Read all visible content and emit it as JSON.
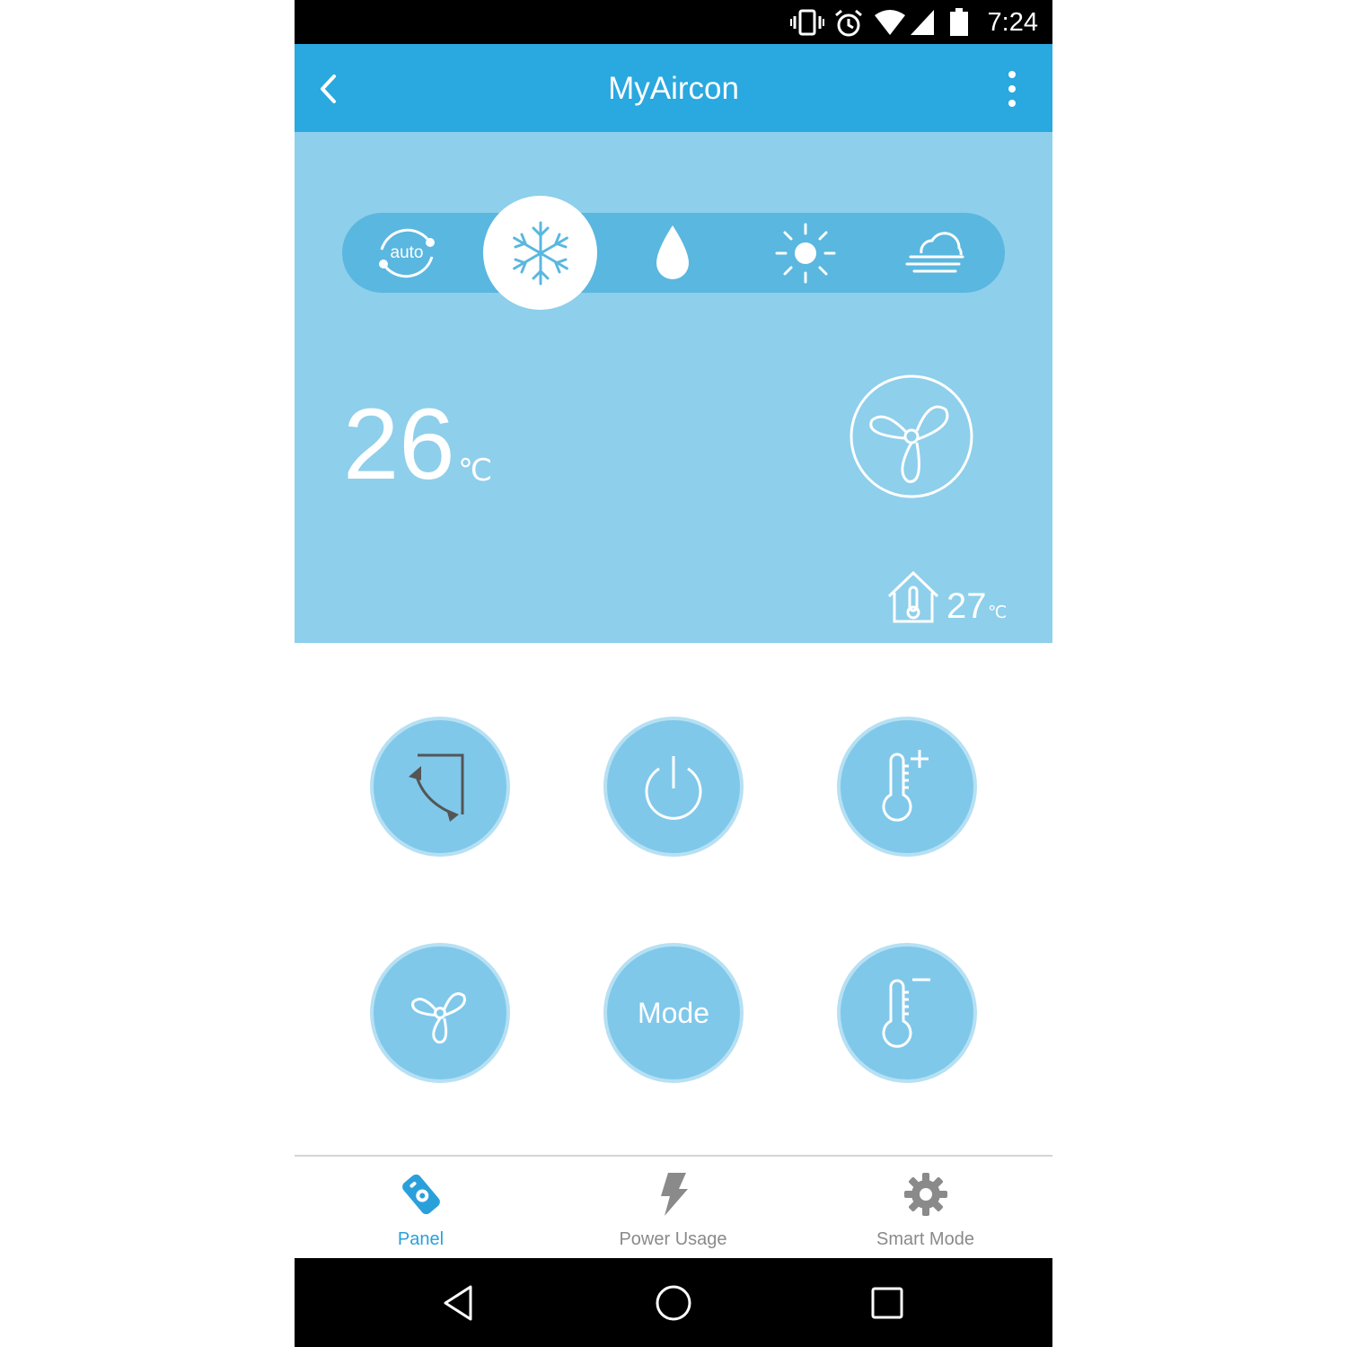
{
  "status_bar": {
    "time": "7:24",
    "icons": [
      "vibrate-icon",
      "alarm-icon",
      "wifi-icon",
      "signal-icon",
      "battery-icon"
    ]
  },
  "app_bar": {
    "title": "MyAircon",
    "back_icon": "chevron-left-icon",
    "menu_icon": "more-vert-icon"
  },
  "modes": {
    "items": [
      {
        "name": "auto",
        "label": "auto",
        "icon": "auto-cycle-icon"
      },
      {
        "name": "cool",
        "icon": "snowflake-icon",
        "selected": true
      },
      {
        "name": "dry",
        "icon": "droplet-icon"
      },
      {
        "name": "heat",
        "icon": "sun-icon"
      },
      {
        "name": "fan",
        "icon": "wind-cloud-icon"
      }
    ],
    "active_color": "#5ab7df"
  },
  "display": {
    "set_temperature": "26",
    "set_unit": "℃",
    "indoor_temperature": "27",
    "indoor_unit": "℃"
  },
  "controls": {
    "mode_label": "Mode",
    "buttons": [
      "swing-button",
      "power-button",
      "temp-up-button",
      "fan-speed-button",
      "mode-button",
      "temp-down-button"
    ]
  },
  "tabs": [
    {
      "label": "Panel",
      "icon": "remote-icon",
      "active": true
    },
    {
      "label": "Power Usage",
      "icon": "lightning-icon",
      "active": false
    },
    {
      "label": "Smart Mode",
      "icon": "gear-icon",
      "active": false
    }
  ],
  "colors": {
    "primary": "#2aa8e0",
    "panel_bg": "#8ecfeb",
    "button_bg": "#7fc8ea",
    "tab_active": "#2aa0da"
  }
}
